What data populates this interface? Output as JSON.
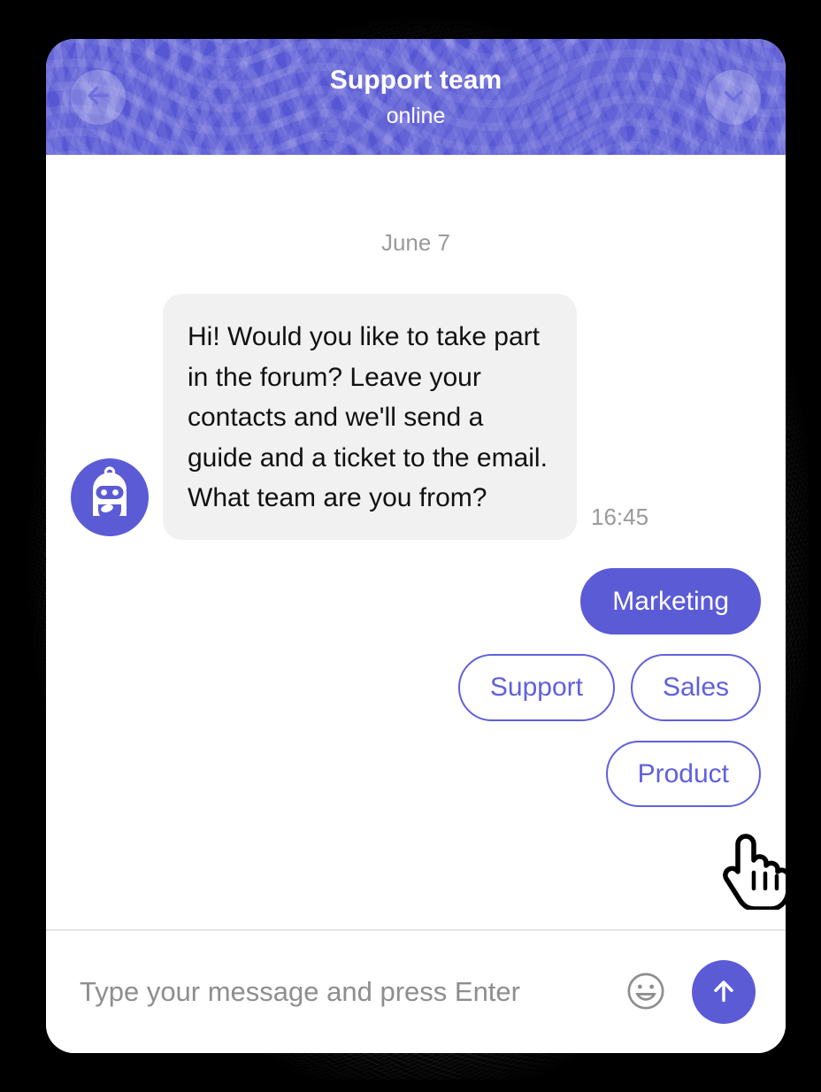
{
  "theme": {
    "brand_purple": "#5b5bd6",
    "header_purple": "#5757d4",
    "outline_purple": "#6060dd",
    "bubble_gray": "#f1f1f1",
    "muted_text": "#9a9a9a",
    "backdrop": "#000000"
  },
  "header": {
    "title": "Support team",
    "status": "online",
    "back_icon": "arrow-left-icon",
    "minimize_icon": "chevron-down-icon"
  },
  "conversation": {
    "date_divider": "June 7",
    "messages": [
      {
        "sender": "bot",
        "avatar_icon": "robot-avatar-icon",
        "text": "Hi! Would you like to take part in the forum? Leave your contacts and we'll send a guide and a ticket to the email.\nWhat team are you from?",
        "time": "16:45"
      }
    ],
    "quick_replies": [
      {
        "label": "Marketing",
        "state": "hovered"
      },
      {
        "label": "Support",
        "state": "default"
      },
      {
        "label": "Sales",
        "state": "default"
      },
      {
        "label": "Product",
        "state": "default"
      }
    ]
  },
  "composer": {
    "placeholder": "Type your message and press Enter",
    "value": "",
    "emoji_icon": "smiley-face-icon",
    "send_icon": "arrow-up-icon"
  },
  "cursor": {
    "icon": "pointing-hand-cursor"
  }
}
